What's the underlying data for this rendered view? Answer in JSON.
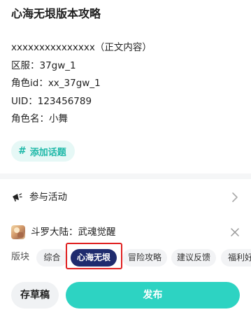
{
  "post": {
    "title": "心海无垠版本攻略",
    "body_lines": [
      "xxxxxxxxxxxxxxx（正文内容）",
      "区服：37gw_1",
      "角色id：xx_37gw_1",
      "UID：123456789",
      "角色名：小舞"
    ]
  },
  "topic": {
    "icon": "hash-icon",
    "label": "添加话题"
  },
  "activity": {
    "icon": "megaphone-icon",
    "label": "参与活动"
  },
  "game": {
    "name": "斗罗大陆：武魂觉醒"
  },
  "board": {
    "label": "版块",
    "tags": [
      "综合",
      "心海无垠",
      "冒险攻略",
      "建议反馈",
      "福利好"
    ],
    "selected": "心海无垠"
  },
  "actions": {
    "draft": "存草稿",
    "publish": "发布"
  },
  "colors": {
    "accent": "#2dd3c2",
    "selected_tag": "#1f2b6e",
    "highlight": "#e02020"
  }
}
